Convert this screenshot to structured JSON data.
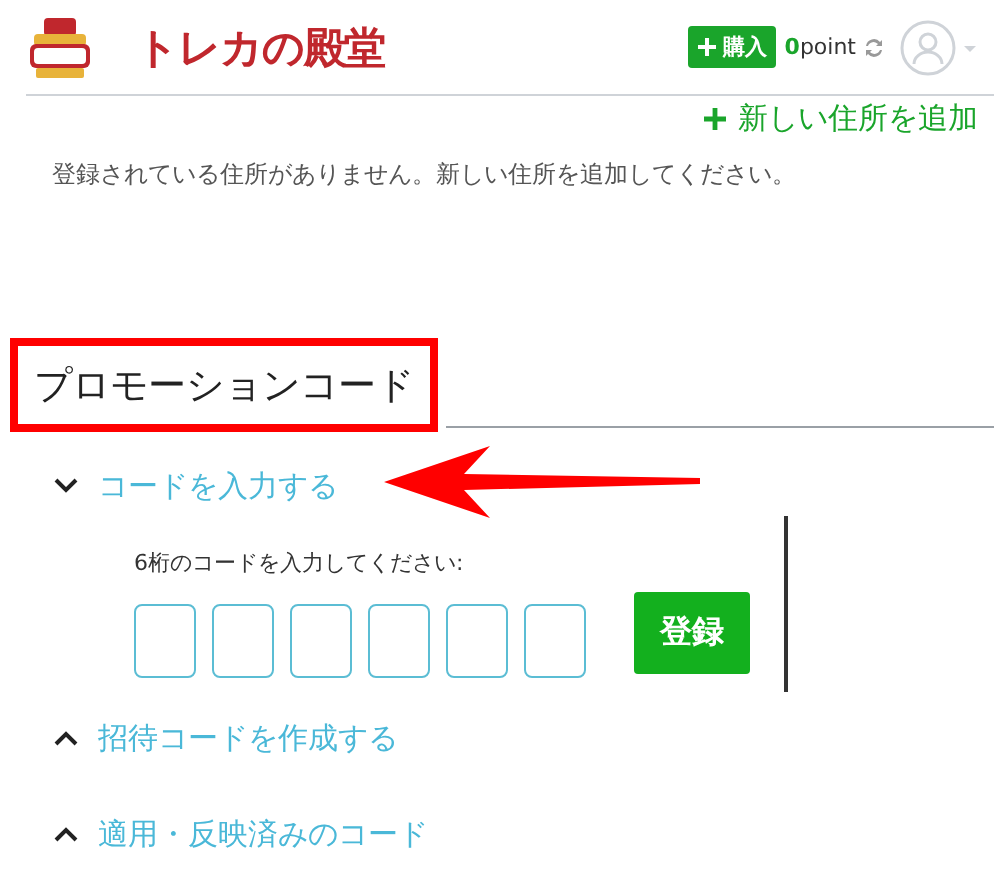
{
  "header": {
    "logo_text": "トレカの殿堂",
    "buy_button": "購入",
    "points_value": "0",
    "points_unit": "point"
  },
  "address": {
    "add_link": "新しい住所を追加",
    "empty_message": "登録されている住所がありません。新しい住所を追加してください。"
  },
  "promotion": {
    "title": "プロモーションコード",
    "highlighted": true,
    "sections": [
      {
        "label": "コードを入力する",
        "expanded": true,
        "annotated": true,
        "prompt": "6桁のコードを入力してください:",
        "digit_boxes": [
          {
            "filled": false
          },
          {
            "filled": false
          },
          {
            "filled": false
          },
          {
            "filled": false
          },
          {
            "filled": false
          },
          {
            "filled": false
          }
        ],
        "submit": "登録"
      },
      {
        "label": "招待コードを作成する",
        "expanded": false,
        "annotated": false
      },
      {
        "label": "適用・反映済みのコード",
        "expanded": false,
        "annotated": false
      }
    ]
  }
}
